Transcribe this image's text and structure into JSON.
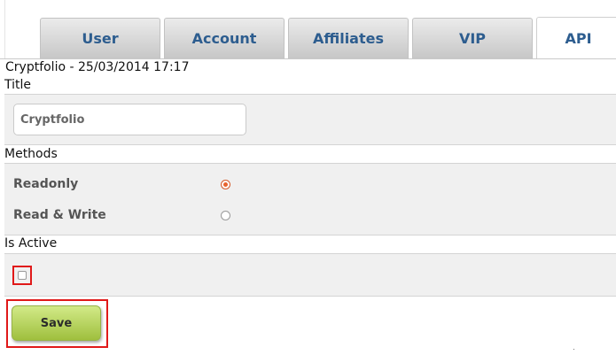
{
  "tabs": [
    {
      "label": "User",
      "active": false
    },
    {
      "label": "Account",
      "active": false
    },
    {
      "label": "Affiliates",
      "active": false
    },
    {
      "label": "VIP",
      "active": false
    },
    {
      "label": "API",
      "active": true
    }
  ],
  "api_key": {
    "header": "Cryptfolio - 25/03/2014 17:17"
  },
  "title_section": {
    "label": "Title",
    "input_value": "",
    "input_placeholder": "Cryptfolio"
  },
  "methods_section": {
    "label": "Methods",
    "options": [
      {
        "label": "Readonly",
        "selected": true
      },
      {
        "label": "Read & Write",
        "selected": false
      }
    ]
  },
  "active_section": {
    "label": "Is Active",
    "checked": false
  },
  "actions": {
    "save_label": "Save"
  },
  "colors": {
    "tab_text": "#2d5d8f",
    "panel_bg": "#f0f0f0",
    "save_gradient_top": "#d2ea88",
    "save_gradient_bottom": "#9fbf3d",
    "highlight": "#e01919",
    "radio_selected": "#e8642e"
  }
}
